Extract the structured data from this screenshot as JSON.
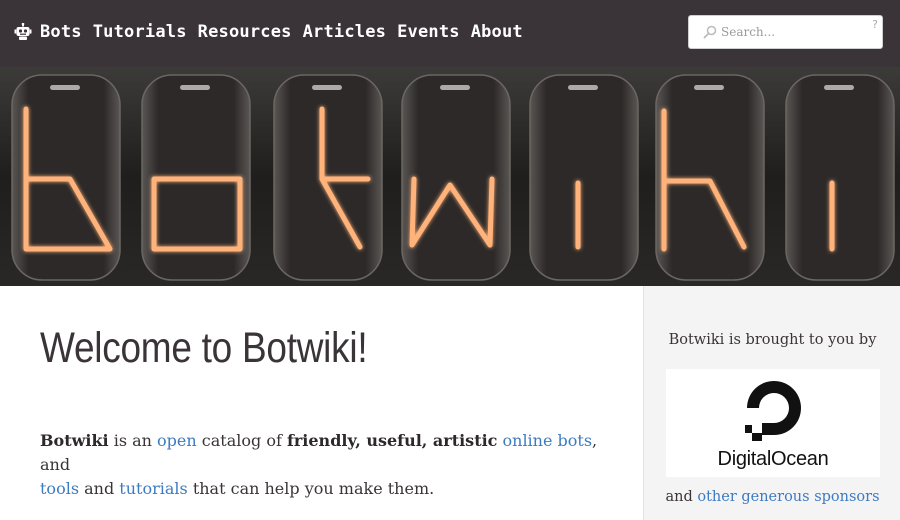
{
  "nav": {
    "items": [
      {
        "label": "Bots"
      },
      {
        "label": "Tutorials"
      },
      {
        "label": "Resources"
      },
      {
        "label": "Articles"
      },
      {
        "label": "Events"
      },
      {
        "label": "About"
      }
    ],
    "logo_icon": "robot-icon"
  },
  "search": {
    "placeholder": "Search...",
    "help": "?"
  },
  "hero": {
    "text": "botwiki"
  },
  "main": {
    "title": "Welcome to Botwiki!",
    "intro": {
      "t1": "Botwiki",
      "t2": " is an ",
      "link_open": "open",
      "t3": " catalog of ",
      "t4": "friendly, useful, artistic",
      "t5": " ",
      "link_online_bots": "online bots",
      "t6": ", and",
      "link_tools": "tools",
      "t7": " and ",
      "link_tutorials": "tutorials",
      "t8": " that can help you make them."
    }
  },
  "sidebar": {
    "brought_by": "Botwiki is brought to you by",
    "sponsor_name": "DigitalOcean",
    "others_prefix": "and ",
    "others_link": "other generous sponsors"
  },
  "colors": {
    "topbar": "#3a3438",
    "link": "#3c7bc2",
    "text": "#3a3438",
    "tube_glow": "#ff6a2a"
  }
}
